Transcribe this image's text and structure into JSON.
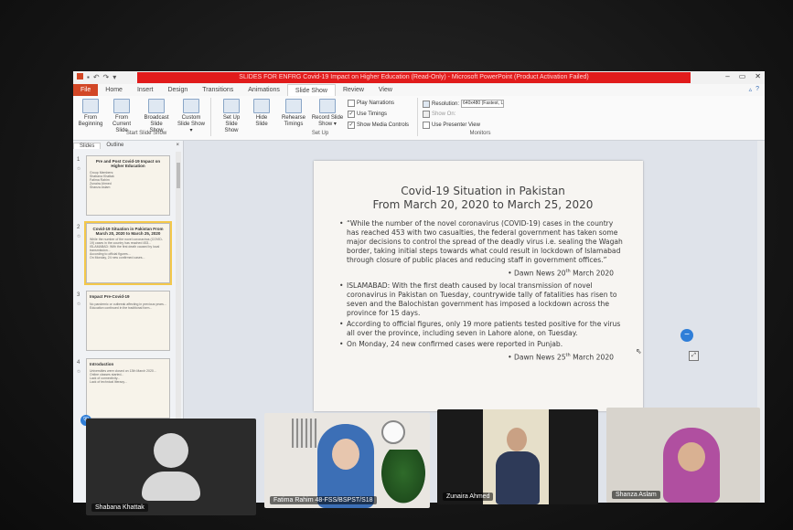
{
  "window": {
    "title": "SLIDES FOR ENFRG Covid-19 Impact on Higher Education (Read-Only) - Microsoft PowerPoint (Product Activation Failed)",
    "controls": [
      "–",
      "▭",
      "✕"
    ]
  },
  "ribbon_tabs": [
    "File",
    "Home",
    "Insert",
    "Design",
    "Transitions",
    "Animations",
    "Slide Show",
    "Review",
    "View"
  ],
  "ribbon": {
    "start_group": {
      "label": "Start Slide Show",
      "buttons": [
        "From Beginning",
        "From Current Slide",
        "Broadcast Slide Show",
        "Custom Slide Show ▾"
      ]
    },
    "setup_group": {
      "label": "Set Up",
      "buttons": [
        "Set Up Slide Show",
        "Hide Slide",
        "Rehearse Timings",
        "Record Slide Show ▾"
      ],
      "checkboxes": [
        {
          "label": "Play Narrations",
          "checked": false
        },
        {
          "label": "Use Timings",
          "checked": true
        },
        {
          "label": "Show Media Controls",
          "checked": true
        }
      ]
    },
    "monitors_group": {
      "label": "Monitors",
      "resolution_label": "Resolution:",
      "resolution_value": "640x480 (Fastest, Lowe...",
      "show_on_label": "Show On:",
      "presenter_view_label": "Use Presenter View"
    }
  },
  "left_pane": {
    "tabs": [
      "Slides",
      "Outline"
    ],
    "close": "×",
    "thumbnails": [
      {
        "num": "1",
        "title": "Pre and Post Covid-19 Impact on Higher Education",
        "lines": [
          "Group Members:",
          "Shabana Khattak",
          "Fatima Rahim",
          "Zunaira Ahmed",
          "Shanza Aslam"
        ]
      },
      {
        "num": "2",
        "title": "Covid-19 Situation in Pakistan From March 20, 2020 to March 25, 2020",
        "lines": [
          "While the number of the novel coronavirus (COVID-19) cases in the country has reached 453...",
          "ISLAMABAD: With the first death caused by local transmission...",
          "According to official figures...",
          "On Monday, 24 new confirmed cases..."
        ]
      },
      {
        "num": "3",
        "title": "Impact Pre-Covid-19",
        "lines": [
          "No pandemic or outbreak affecting in previous years...",
          "Education continued in the traditional form..."
        ]
      },
      {
        "num": "4",
        "title": "Introduction",
        "lines": [
          "Universities were closed on 13th March 2020...",
          "Online classes started...",
          "Lack of connectivity...",
          "Lack of technical literacy..."
        ]
      }
    ]
  },
  "slide": {
    "title_line1": "Covid-19 Situation in Pakistan",
    "title_line2": "From March 20, 2020 to March 25, 2020",
    "bullets": [
      {
        "text": "“While the number of the novel coronavirus (COVID-19) cases in the country has reached 453 with two casualties, the federal government has taken some major decisions to control the spread of the deadly virus i.e. sealing the Wagah border, taking initial steps towards what could result in lockdown of Islamabad through closure of public places and reducing staff in government offices.”"
      },
      {
        "text": "ISLAMABAD: With the first death caused by local transmission of novel coronavirus in Pakistan on Tuesday, countrywide tally of fatalities has risen to seven and the Balochistan government has imposed a lockdown across the province for 15 days."
      },
      {
        "text": "According to official figures, only 19 more patients tested positive for the virus all over the province, including seven in Lahore alone, on Tuesday."
      },
      {
        "text": "On Monday, 24 new confirmed cases were reported in Punjab."
      }
    ],
    "source1_prefix": "• Dawn News 20",
    "source1_sup": "th",
    "source1_suffix": " March 2020",
    "source2_prefix": "• Dawn News 25",
    "source2_sup": "th",
    "source2_suffix": " March 2020"
  },
  "participants": [
    {
      "name": "Shabana Khattak",
      "video": false
    },
    {
      "name": "Fatima Rahim 48-FSS/BSPST/S18",
      "video": true
    },
    {
      "name": "Zunaira Ahmed",
      "video": true
    },
    {
      "name": "Shanza Aslam",
      "video": true
    }
  ],
  "colors": {
    "title_bar_red": "#e11b1b",
    "file_tab": "#d24726",
    "zoom_blue": "#2f7ed8",
    "selected_thumb": "#f4c84a"
  }
}
